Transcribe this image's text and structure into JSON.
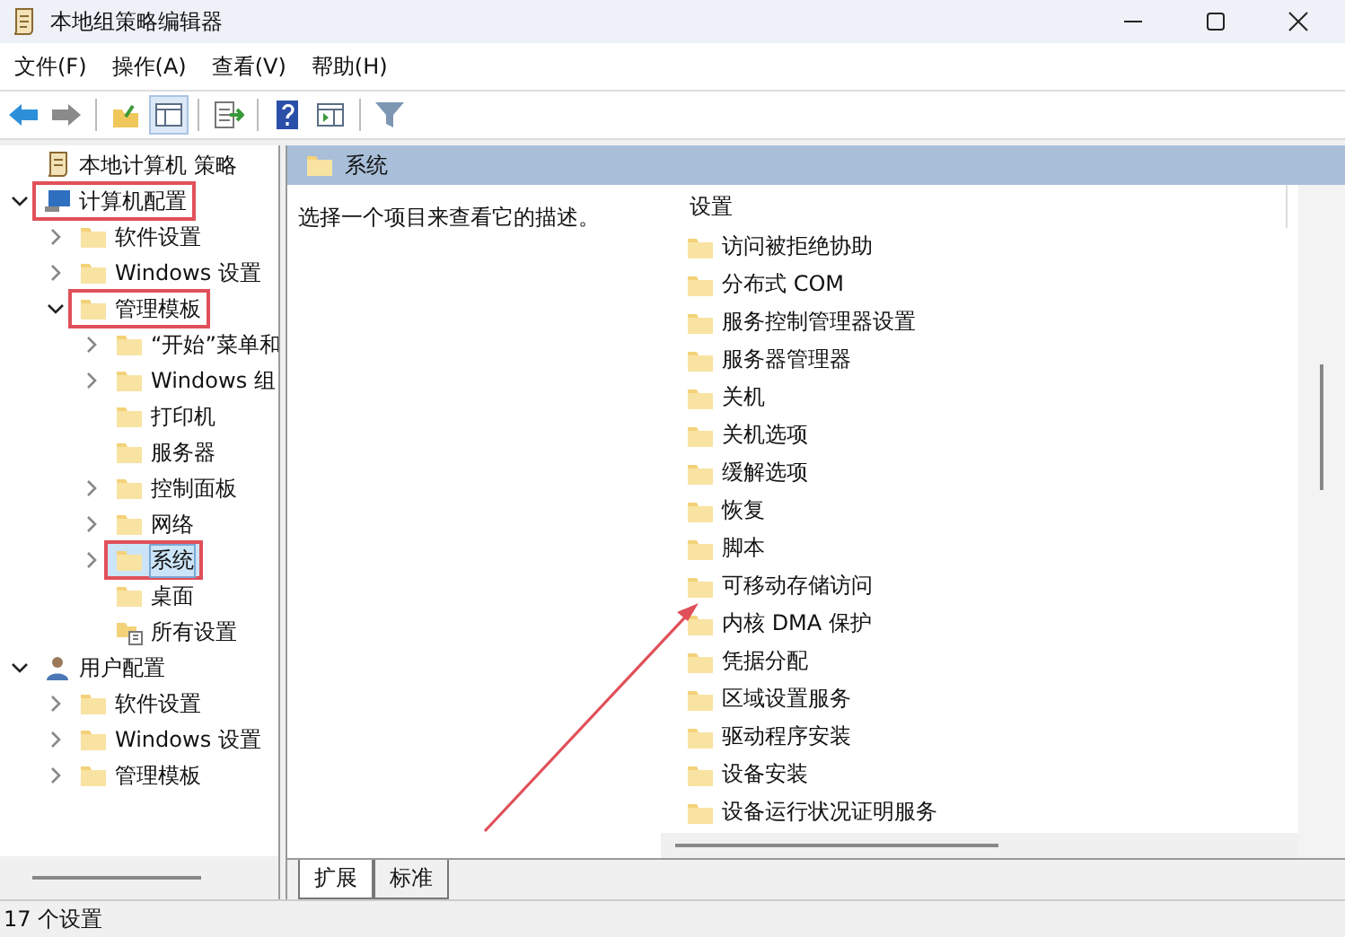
{
  "window": {
    "title": "本地组策略编辑器"
  },
  "menu": [
    "文件(F)",
    "操作(A)",
    "查看(V)",
    "帮助(H)"
  ],
  "toolbar": [
    {
      "kind": "back",
      "pressed": false
    },
    {
      "kind": "forward",
      "pressed": false
    },
    {
      "kind": "sep"
    },
    {
      "kind": "up",
      "pressed": false
    },
    {
      "kind": "tree",
      "pressed": true
    },
    {
      "kind": "sep"
    },
    {
      "kind": "export",
      "pressed": false
    },
    {
      "kind": "sep"
    },
    {
      "kind": "help",
      "pressed": false
    },
    {
      "kind": "pane",
      "pressed": false
    },
    {
      "kind": "sep"
    },
    {
      "kind": "filter",
      "pressed": false
    }
  ],
  "tree": [
    {
      "label": "本地计算机 策略",
      "kind": "policy",
      "selected": false,
      "highlighted": false,
      "children": [
        {
          "label": "计算机配置",
          "kind": "computer",
          "expanded": true,
          "selected": false,
          "highlighted": true,
          "children": [
            {
              "label": "软件设置",
              "kind": "folder",
              "expanded": false,
              "selected": false,
              "highlighted": false
            },
            {
              "label": "Windows 设置",
              "kind": "folder",
              "expanded": false,
              "selected": false,
              "highlighted": false
            },
            {
              "label": "管理模板",
              "kind": "folder",
              "expanded": true,
              "selected": false,
              "highlighted": true,
              "children": [
                {
                  "label": "“开始”菜单和",
                  "kind": "folder",
                  "expanded": false,
                  "selected": false,
                  "highlighted": false
                },
                {
                  "label": "Windows 组",
                  "kind": "folder",
                  "expanded": false,
                  "selected": false,
                  "highlighted": false
                },
                {
                  "label": "打印机",
                  "kind": "folder",
                  "selected": false,
                  "highlighted": false
                },
                {
                  "label": "服务器",
                  "kind": "folder",
                  "selected": false,
                  "highlighted": false
                },
                {
                  "label": "控制面板",
                  "kind": "folder",
                  "expanded": false,
                  "selected": false,
                  "highlighted": false
                },
                {
                  "label": "网络",
                  "kind": "folder",
                  "expanded": false,
                  "selected": false,
                  "highlighted": false
                },
                {
                  "label": "系统",
                  "kind": "folder",
                  "expanded": false,
                  "selected": true,
                  "highlighted": true
                },
                {
                  "label": "桌面",
                  "kind": "folder",
                  "selected": false,
                  "highlighted": false
                },
                {
                  "label": "所有设置",
                  "kind": "settings",
                  "selected": false,
                  "highlighted": false
                }
              ]
            }
          ]
        },
        {
          "label": "用户配置",
          "kind": "user",
          "expanded": true,
          "selected": false,
          "highlighted": false,
          "children": [
            {
              "label": "软件设置",
              "kind": "folder",
              "expanded": false,
              "selected": false,
              "highlighted": false
            },
            {
              "label": "Windows 设置",
              "kind": "folder",
              "expanded": false,
              "selected": false,
              "highlighted": false
            },
            {
              "label": "管理模板",
              "kind": "folder",
              "expanded": false,
              "selected": false,
              "highlighted": false
            }
          ]
        }
      ]
    }
  ],
  "details": {
    "header": "系统",
    "description": "选择一个项目来查看它的描述。",
    "column": "设置",
    "items": [
      "访问被拒绝协助",
      "分布式 COM",
      "服务控制管理器设置",
      "服务器管理器",
      "关机",
      "关机选项",
      "缓解选项",
      "恢复",
      "脚本",
      "可移动存储访问",
      "内核 DMA 保护",
      "凭据分配",
      "区域设置服务",
      "驱动程序安装",
      "设备安装",
      "设备运行状况证明服务"
    ]
  },
  "tabs": [
    {
      "label": "扩展",
      "selected": true
    },
    {
      "label": "标准",
      "selected": false
    }
  ],
  "status_bar": "17 个设置"
}
